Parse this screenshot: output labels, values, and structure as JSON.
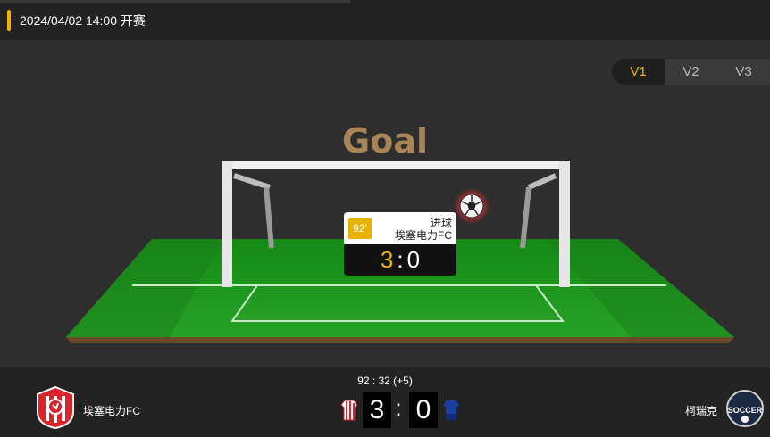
{
  "header": {
    "datetime": "2024/04/02 14:00 开赛"
  },
  "version_tabs": [
    {
      "label": "V1",
      "active": true
    },
    {
      "label": "V2",
      "active": false
    },
    {
      "label": "V3",
      "active": false
    }
  ],
  "animation": {
    "event_title": "Goal",
    "card": {
      "minute": "92'",
      "event_type": "进球",
      "team": "埃塞电力FC",
      "home_score": "3",
      "separator": ":",
      "away_score": "0"
    }
  },
  "match": {
    "clock": "92 : 32  (+5)",
    "home": {
      "name": "埃塞电力FC",
      "score": "3",
      "kit_color": "#d9242b",
      "logo_icon": "home-team-logo-icon"
    },
    "away": {
      "name": "柯瑞克",
      "score": "0",
      "kit_color": "#1a3fa0",
      "logo_icon": "away-team-logo-icon",
      "logo_text": "SOCCER"
    },
    "separator": ":"
  },
  "colors": {
    "accent": "#f0b400",
    "grass": "#1f8a1f",
    "title": "#a88556"
  }
}
